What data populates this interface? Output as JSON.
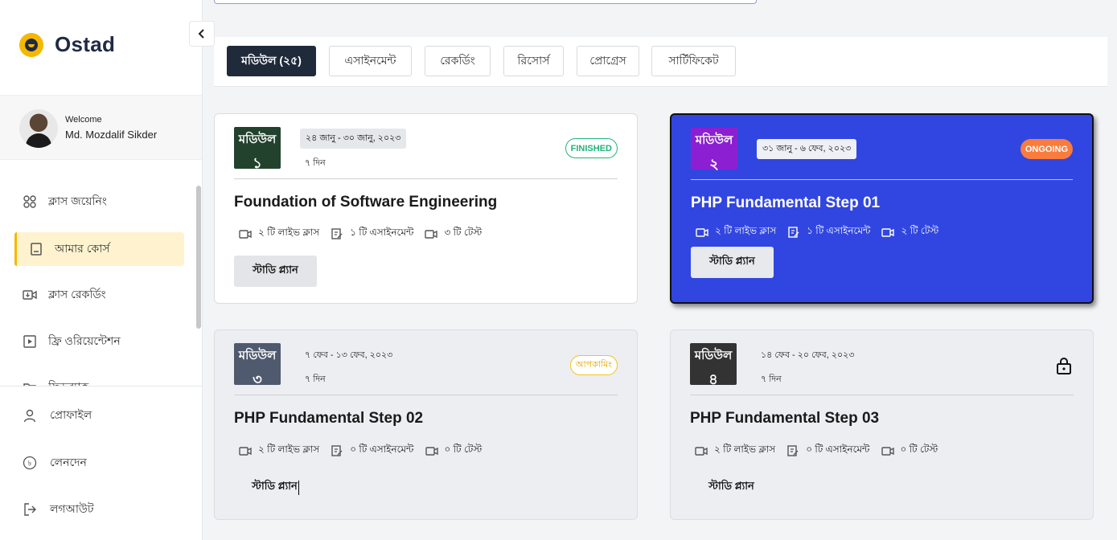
{
  "brand": {
    "name": "Ostad"
  },
  "user": {
    "welcome": "Welcome",
    "name": "Md. Mozdalif Sikder"
  },
  "sidebar": {
    "items": [
      {
        "label": "ক্লাস জয়েনিং",
        "icon": "grid-icon"
      },
      {
        "label": "আমার কোর্স",
        "icon": "book-icon",
        "active": true
      },
      {
        "label": "ক্লাস রেকর্ডিং",
        "icon": "video-download-icon"
      },
      {
        "label": "ফ্রি ওরিয়েন্টেশন",
        "icon": "play-icon"
      },
      {
        "label": "ফিডব্যাক",
        "icon": "folder-icon"
      }
    ],
    "bottom": [
      {
        "label": "প্রোফাইল",
        "icon": "user-icon"
      },
      {
        "label": "লেনদেন",
        "icon": "taka-icon"
      },
      {
        "label": "লগআউট",
        "icon": "logout-icon"
      }
    ]
  },
  "tabs": [
    {
      "label": "মডিউল (২৫)",
      "active": true
    },
    {
      "label": "এসাইনমেন্ট"
    },
    {
      "label": "রেকর্ডিং"
    },
    {
      "label": "রিসোর্স"
    },
    {
      "label": "প্রোগ্রেস"
    },
    {
      "label": "সার্টিফিকেট"
    }
  ],
  "modules": [
    {
      "badge_word": "মডিউল",
      "badge_num": "১",
      "badge_color": "#22422e",
      "date": "২৪ জানু - ৩০ জানু, ২০২৩",
      "days": "৭ দিন",
      "status": "FINISHED",
      "title": "Foundation of Software Engineering",
      "live": "২ টি লাইভ ক্লাস",
      "assign": "১ টি এসাইনমেন্ট",
      "test": "৩ টি টেস্ট",
      "button": "স্টাডি প্ল্যান"
    },
    {
      "badge_word": "মডিউল",
      "badge_num": "২",
      "badge_color": "#8b1fd1",
      "date": "৩১ জানু - ৬ ফেব, ২০২৩",
      "days": "",
      "status": "ONGOING",
      "title": "PHP Fundamental Step 01",
      "live": "২ টি লাইভ ক্লাস",
      "assign": "১ টি এসাইনমেন্ট",
      "test": "২ টি টেস্ট",
      "button": "স্টাডি প্ল্যান"
    },
    {
      "badge_word": "মডিউল",
      "badge_num": "৩",
      "badge_color": "#4f5a6e",
      "date": "৭ ফেব - ১৩ ফেব, ২০২৩",
      "days": "৭ দিন",
      "status": "আপকামিং",
      "title": "PHP Fundamental Step 02",
      "live": "২ টি লাইভ ক্লাস",
      "assign": "০ টি এসাইনমেন্ট",
      "test": "০ টি টেস্ট",
      "button": "স্টাডি প্ল্যান"
    },
    {
      "badge_word": "মডিউল",
      "badge_num": "৪",
      "badge_color": "#333333",
      "date": "১৪ ফেব - ২০ ফেব, ২০২৩",
      "days": "৭ দিন",
      "status": "locked",
      "title": "PHP Fundamental Step 03",
      "live": "২ টি লাইভ ক্লাস",
      "assign": "০ টি এসাইনমেন্ট",
      "test": "০ টি টেস্ট",
      "button": "স্টাডি প্ল্যান"
    }
  ]
}
